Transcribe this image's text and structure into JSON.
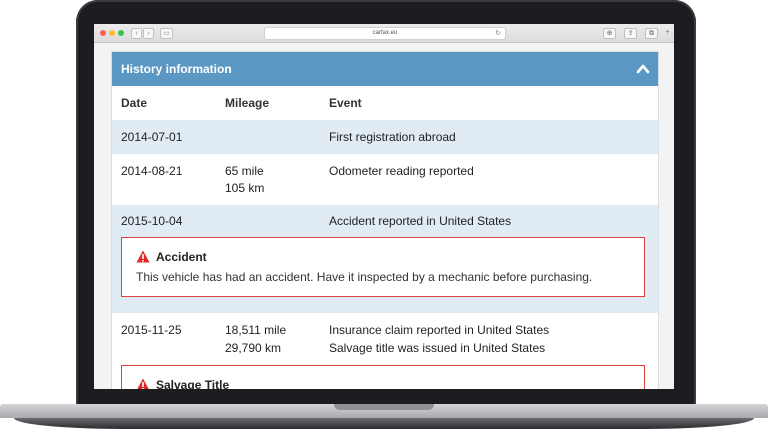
{
  "browser": {
    "url": "carfax.eu"
  },
  "panel": {
    "title": "History information",
    "columns": {
      "date": "Date",
      "mileage": "Mileage",
      "event": "Event"
    }
  },
  "rows": [
    {
      "date": "2014-07-01",
      "mileage_mi": "",
      "mileage_km": "",
      "events": [
        "First registration abroad"
      ]
    },
    {
      "date": "2014-08-21",
      "mileage_mi": "65 mile",
      "mileage_km": "105 km",
      "events": [
        "Odometer reading reported"
      ]
    },
    {
      "date": "2015-10-04",
      "mileage_mi": "",
      "mileage_km": "",
      "events": [
        "Accident reported in United States"
      ]
    },
    {
      "date": "2015-11-25",
      "mileage_mi": "18,511 mile",
      "mileage_km": "29,790 km",
      "events": [
        "Insurance claim reported in United States",
        "Salvage title was issued in United States"
      ]
    }
  ],
  "alerts": [
    {
      "title": "Accident",
      "text": "This vehicle has had an accident. Have it inspected by a mechanic before purchasing."
    },
    {
      "title": "Salvage Title",
      "text": ""
    }
  ],
  "colors": {
    "header": "#5a97c2",
    "shade": "#e0ebf3",
    "alert_border": "#e24141"
  }
}
